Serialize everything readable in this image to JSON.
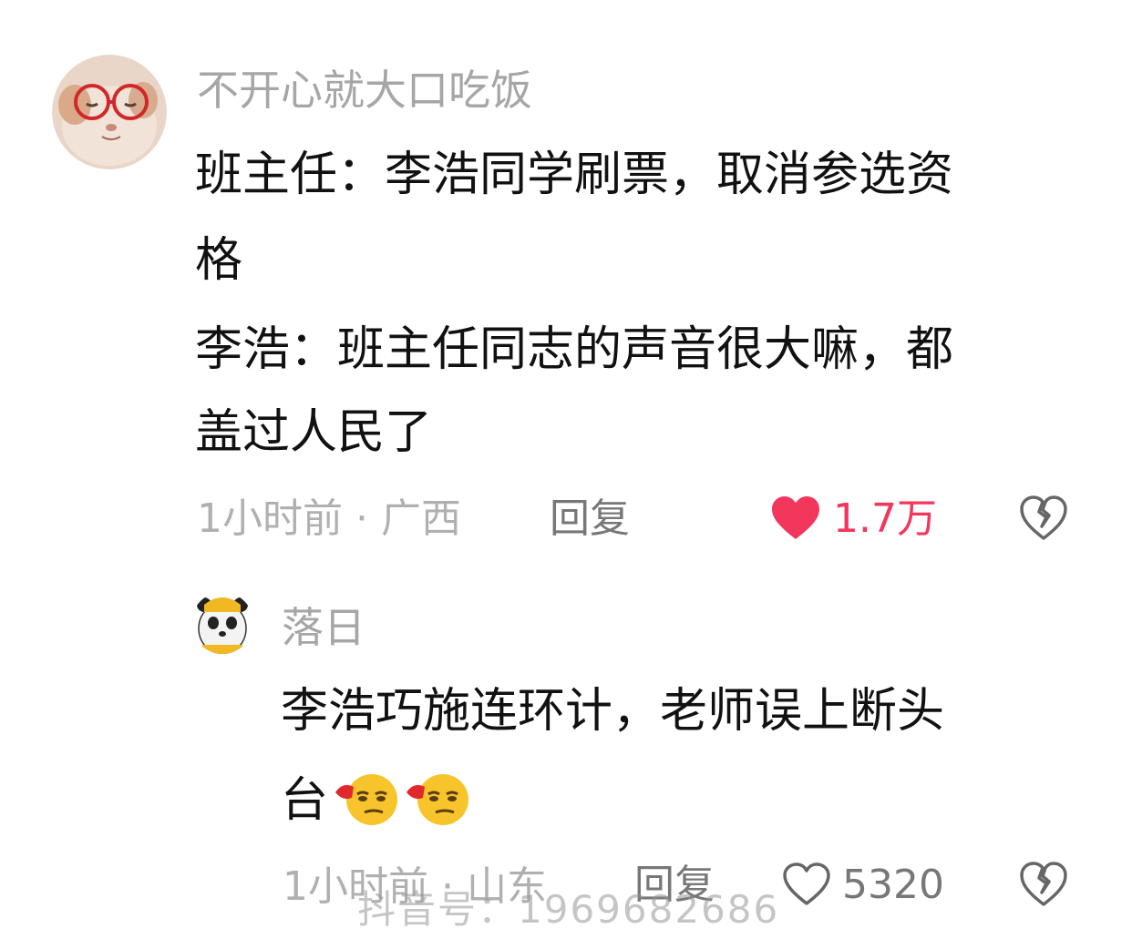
{
  "comments": [
    {
      "username": "不开心就大口吃饭",
      "lines": [
        "班主任：李浩同学刷票，取消参选资",
        "格",
        "李浩：班主任同志的声音很大嘛，都",
        "盖过人民了"
      ],
      "time_location": "1小时前 · 广西",
      "reply_label": "回复",
      "likes": "1.7万",
      "liked": true
    },
    {
      "username": "落日",
      "lines": [
        "李浩巧施连环计，老师误上断头",
        "台"
      ],
      "time_location": "1小时前 · 山东",
      "reply_label": "回复",
      "likes": "5320",
      "liked": false
    }
  ],
  "watermark": "抖音号：1969682686",
  "icons": {
    "like_filled": "heart-filled-icon",
    "like_outline": "heart-outline-icon",
    "dislike": "broken-heart-icon",
    "emoji": "smirk-emoji-icon"
  },
  "colors": {
    "like_active": "#f2365c",
    "username": "#a6a6a6",
    "meta": "#b0b0b0"
  }
}
